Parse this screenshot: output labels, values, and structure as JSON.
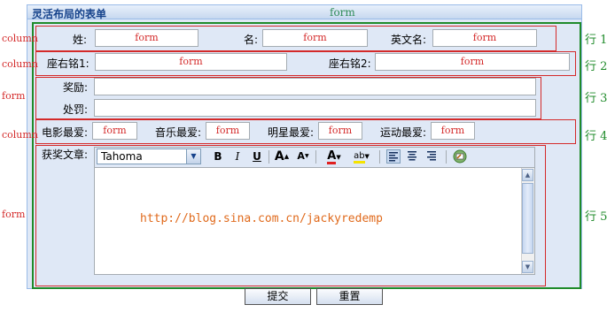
{
  "panel": {
    "title": "灵活布局的表单",
    "header_annotation": "form"
  },
  "row1": {
    "fields": [
      {
        "label": "姓:",
        "value": "form"
      },
      {
        "label": "名:",
        "value": "form"
      },
      {
        "label": "英文名:",
        "value": "form"
      }
    ],
    "side_left": "column",
    "side_right": "行 1"
  },
  "row2": {
    "fields": [
      {
        "label": "座右铭1:",
        "value": "form"
      },
      {
        "label": "座右铭2:",
        "value": "form"
      }
    ],
    "side_left": "column",
    "side_right": "行 2"
  },
  "row3": {
    "fields": [
      {
        "label": "奖励:",
        "value": ""
      },
      {
        "label": "处罚:",
        "value": ""
      }
    ],
    "side_left": "form",
    "side_right": "行 3"
  },
  "row4": {
    "fields": [
      {
        "label": "电影最爱:",
        "value": "form"
      },
      {
        "label": "音乐最爱:",
        "value": "form"
      },
      {
        "label": "明星最爱:",
        "value": "form"
      },
      {
        "label": "运动最爱:",
        "value": "form"
      }
    ],
    "side_left": "column",
    "side_right": "行 4"
  },
  "row5": {
    "label": "获奖文章:",
    "side_left": "form",
    "side_right": "行 5",
    "toolbar": {
      "font": "Tahoma",
      "bold": "B",
      "italic": "I",
      "underline": "U",
      "grow": "A",
      "shrink": "A",
      "forecolor": "A",
      "highlight": "ab"
    },
    "editor_text": "http://blog.sina.com.cn/jackyredemp"
  },
  "buttons": {
    "submit": "提交",
    "reset": "重置"
  }
}
